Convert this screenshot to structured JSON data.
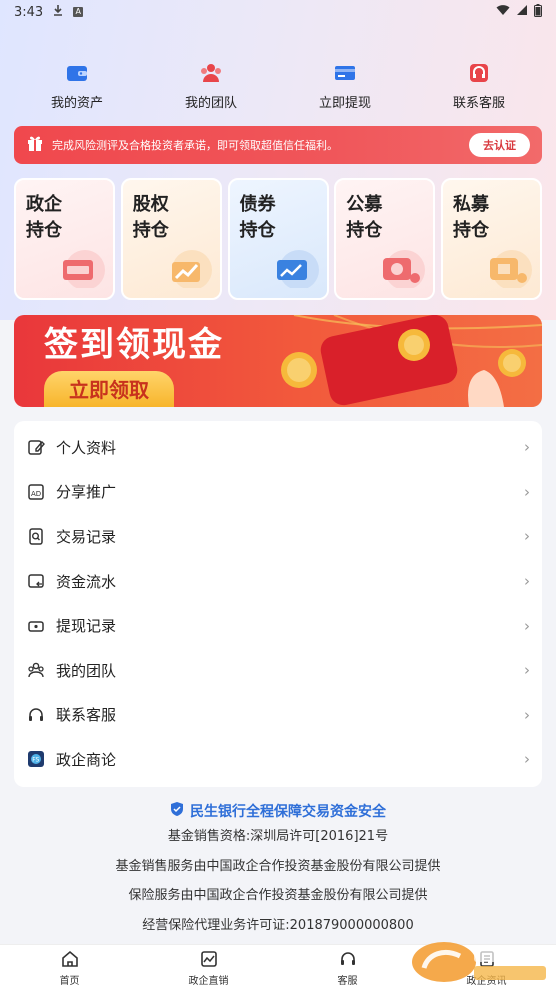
{
  "status": {
    "time": "3:43"
  },
  "quick_actions": [
    {
      "label": "我的资产",
      "icon": "wallet-icon"
    },
    {
      "label": "我的团队",
      "icon": "team-icon"
    },
    {
      "label": "立即提现",
      "icon": "withdraw-card-icon"
    },
    {
      "label": "联系客服",
      "icon": "customer-service-icon"
    }
  ],
  "notice": {
    "text": "完成风险测评及合格投资者承诺，即可领取超值信任福利。",
    "button": "去认证"
  },
  "holdings": [
    {
      "line1": "政企",
      "line2": "持仓"
    },
    {
      "line1": "股权",
      "line2": "持仓"
    },
    {
      "line1": "债券",
      "line2": "持仓"
    },
    {
      "line1": "公募",
      "line2": "持仓"
    },
    {
      "line1": "私募",
      "line2": "持仓"
    }
  ],
  "banner": {
    "title": "签到领现金",
    "button": "立即领取"
  },
  "menu": [
    {
      "label": "个人资料",
      "icon": "profile-edit-icon"
    },
    {
      "label": "分享推广",
      "icon": "share-ad-icon"
    },
    {
      "label": "交易记录",
      "icon": "transaction-record-icon"
    },
    {
      "label": "资金流水",
      "icon": "fund-flow-icon"
    },
    {
      "label": "提现记录",
      "icon": "withdraw-record-icon"
    },
    {
      "label": "我的团队",
      "icon": "team-icon"
    },
    {
      "label": "联系客服",
      "icon": "headset-icon"
    },
    {
      "label": "政企商论",
      "icon": "forum-icon"
    }
  ],
  "footer": {
    "headline": "民生银行全程保障交易资金安全",
    "lines": [
      "基金销售资格:深圳局许可[2016]21号",
      "基金销售服务由中国政企合作投资基金股份有限公司提供",
      "保险服务由中国政企合作投资基金股份有限公司提供",
      "经营保险代理业务许可证:201879000000800"
    ]
  },
  "tabs": [
    {
      "label": "首页",
      "icon": "home-icon"
    },
    {
      "label": "政企直销",
      "icon": "chart-icon"
    },
    {
      "label": "客服",
      "icon": "headset-icon"
    },
    {
      "label": "政企资讯",
      "icon": "news-icon"
    }
  ],
  "colors": {
    "accent_red": "#f0484d",
    "link_blue": "#2f6fd8"
  }
}
